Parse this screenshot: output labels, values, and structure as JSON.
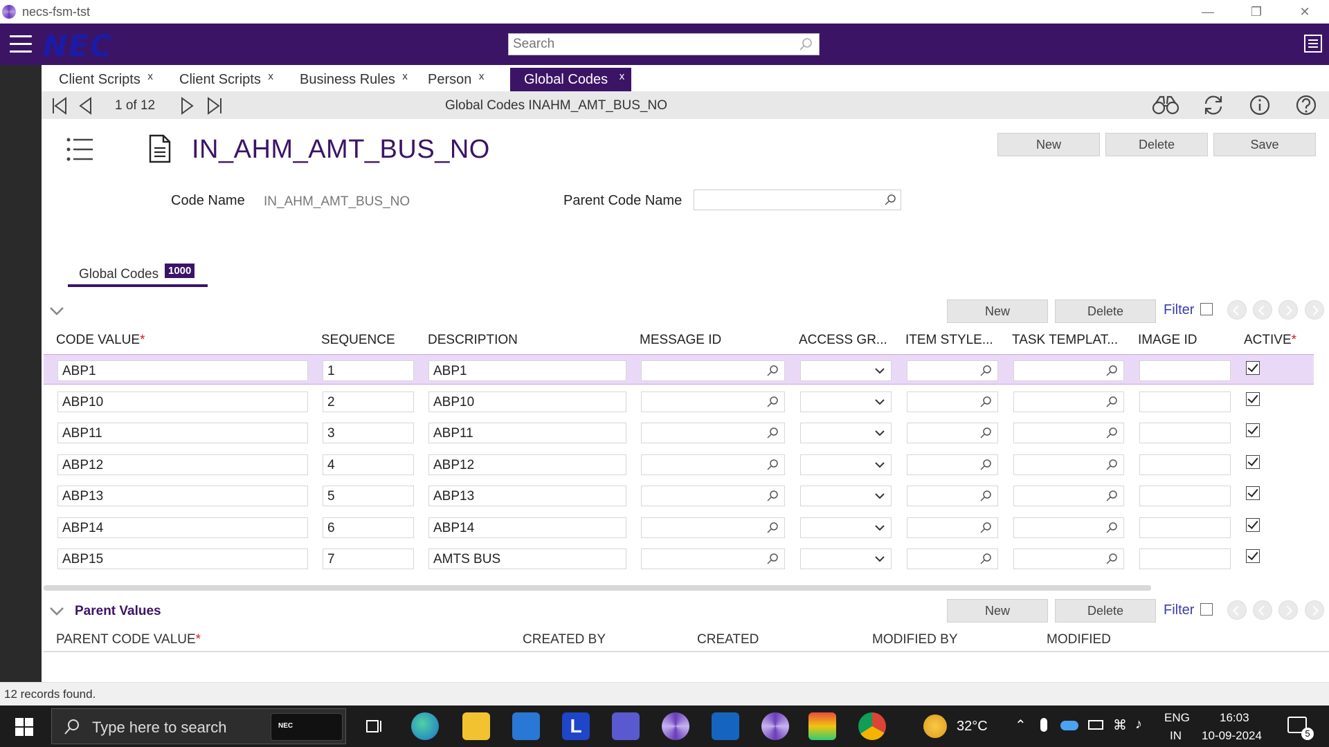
{
  "window": {
    "title": "necs-fsm-tst"
  },
  "header": {
    "logo": "NEC",
    "search_placeholder": "Search"
  },
  "tabs": [
    {
      "label": "Client Scripts",
      "close": "x"
    },
    {
      "label": "Client Scripts",
      "close": "x"
    },
    {
      "label": "Business Rules",
      "close": "x"
    },
    {
      "label": "Person",
      "close": "x"
    },
    {
      "label": "Global Codes",
      "close": "x",
      "active": true
    }
  ],
  "navbar": {
    "pager": "1 of 12",
    "breadcrumb": "Global Codes INAHM_AMT_BUS_NO"
  },
  "form": {
    "title": "IN_AHM_AMT_BUS_NO",
    "buttons": {
      "new": "New",
      "delete": "Delete",
      "save": "Save"
    },
    "code_name_label": "Code Name",
    "code_name_value": "IN_AHM_AMT_BUS_NO",
    "parent_code_label": "Parent Code Name"
  },
  "subtab": {
    "label": "Global Codes",
    "badge": "1000"
  },
  "grid": {
    "buttons": {
      "new": "New",
      "delete": "Delete"
    },
    "filter_label": "Filter",
    "columns": {
      "code_value": "CODE VALUE",
      "sequence": "SEQUENCE",
      "description": "DESCRIPTION",
      "message_id": "MESSAGE ID",
      "access_group": "ACCESS GR...",
      "item_style": "ITEM STYLE...",
      "task_template": "TASK TEMPLAT...",
      "image_id": "IMAGE ID",
      "active": "ACTIVE"
    },
    "required_mark": "*",
    "rows": [
      {
        "code": "ABP1",
        "seq": "1",
        "desc": "ABP1",
        "active": true
      },
      {
        "code": "ABP10",
        "seq": "2",
        "desc": "ABP10",
        "active": true
      },
      {
        "code": "ABP11",
        "seq": "3",
        "desc": "ABP11",
        "active": true
      },
      {
        "code": "ABP12",
        "seq": "4",
        "desc": "ABP12",
        "active": true
      },
      {
        "code": "ABP13",
        "seq": "5",
        "desc": "ABP13",
        "active": true
      },
      {
        "code": "ABP14",
        "seq": "6",
        "desc": "ABP14",
        "active": true
      },
      {
        "code": "ABP15",
        "seq": "7",
        "desc": "AMTS BUS",
        "active": true
      }
    ]
  },
  "parent_values": {
    "title": "Parent Values",
    "buttons": {
      "new": "New",
      "delete": "Delete"
    },
    "filter_label": "Filter",
    "columns": {
      "parent_code_value": "PARENT CODE VALUE",
      "created_by": "CREATED BY",
      "created": "CREATED",
      "modified_by": "MODIFIED BY",
      "modified": "MODIFIED"
    }
  },
  "status": {
    "text": "12 records found."
  },
  "taskbar": {
    "search_placeholder": "Type here to search",
    "thumb_text": "NEC",
    "weather": "32°C",
    "lang_top": "ENG",
    "lang_bottom": "IN",
    "time": "16:03",
    "date": "10-09-2024",
    "notifications": "5"
  },
  "colors": {
    "brand": "#3b1466",
    "selected_row": "#ead9f6"
  }
}
